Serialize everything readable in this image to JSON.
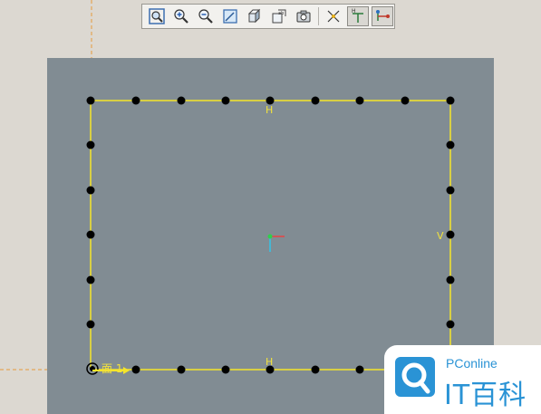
{
  "toolbar": {
    "buttons": [
      {
        "name": "zoom-fit-icon",
        "state": "off"
      },
      {
        "name": "zoom-in-icon",
        "state": "off"
      },
      {
        "name": "zoom-out-icon",
        "state": "off"
      },
      {
        "name": "repaint-icon",
        "state": "off"
      },
      {
        "name": "shading-icon",
        "state": "off"
      },
      {
        "name": "saved-views-icon",
        "state": "off"
      },
      {
        "name": "camera-icon",
        "state": "off"
      },
      {
        "name": "dimension-display-icon",
        "state": "off"
      },
      {
        "name": "constraint-display-icon",
        "state": "on"
      },
      {
        "name": "vertex-display-icon",
        "state": "on"
      }
    ]
  },
  "sketch": {
    "constraint_top": "H",
    "constraint_bottom": "H",
    "constraint_right": "V",
    "origin_label": "面 1",
    "colors": {
      "line": "#f5e52a",
      "point": "#000000",
      "guide": "#e69a3c",
      "canvas": "#818c93"
    }
  },
  "watermark": {
    "brand": "PConline",
    "name": "IT百科",
    "color": "#2a93d5"
  }
}
